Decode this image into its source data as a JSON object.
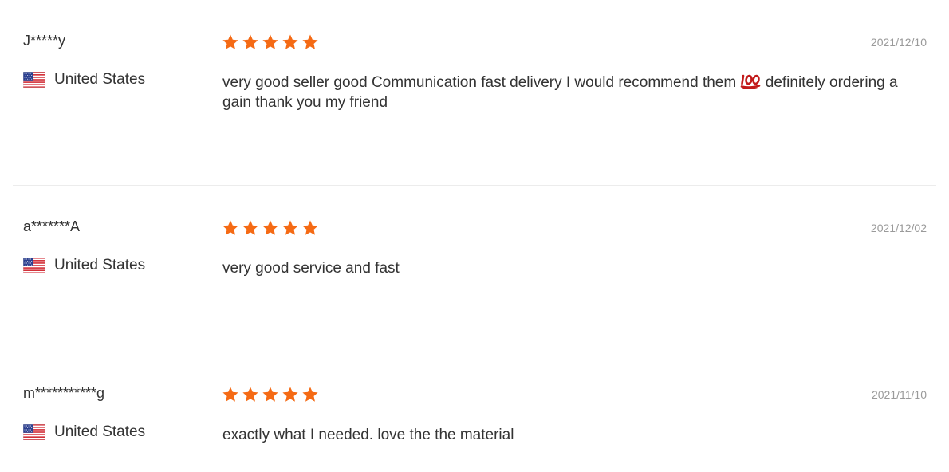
{
  "reviews": [
    {
      "author": "J*****y",
      "country": "United States",
      "country_flag": "us-flag-icon",
      "rating": 5,
      "date": "2021/12/10",
      "text_before_emoji": "very good seller good Communication fast delivery I would recommend them ",
      "emoji": "hundred-points-icon",
      "text_after_emoji": " definitely ordering a gain thank you my friend"
    },
    {
      "author": "a*******A",
      "country": "United States",
      "country_flag": "us-flag-icon",
      "rating": 5,
      "date": "2021/12/02",
      "text": "very good service and fast"
    },
    {
      "author": "m***********g",
      "country": "United States",
      "country_flag": "us-flag-icon",
      "rating": 5,
      "date": "2021/11/10",
      "text": "exactly what I needed. love the the material"
    }
  ],
  "colors": {
    "star": "#f56a14",
    "text": "#333333",
    "date": "#9a9a9a",
    "divider": "#ececec",
    "emoji": "#c21a1a"
  }
}
